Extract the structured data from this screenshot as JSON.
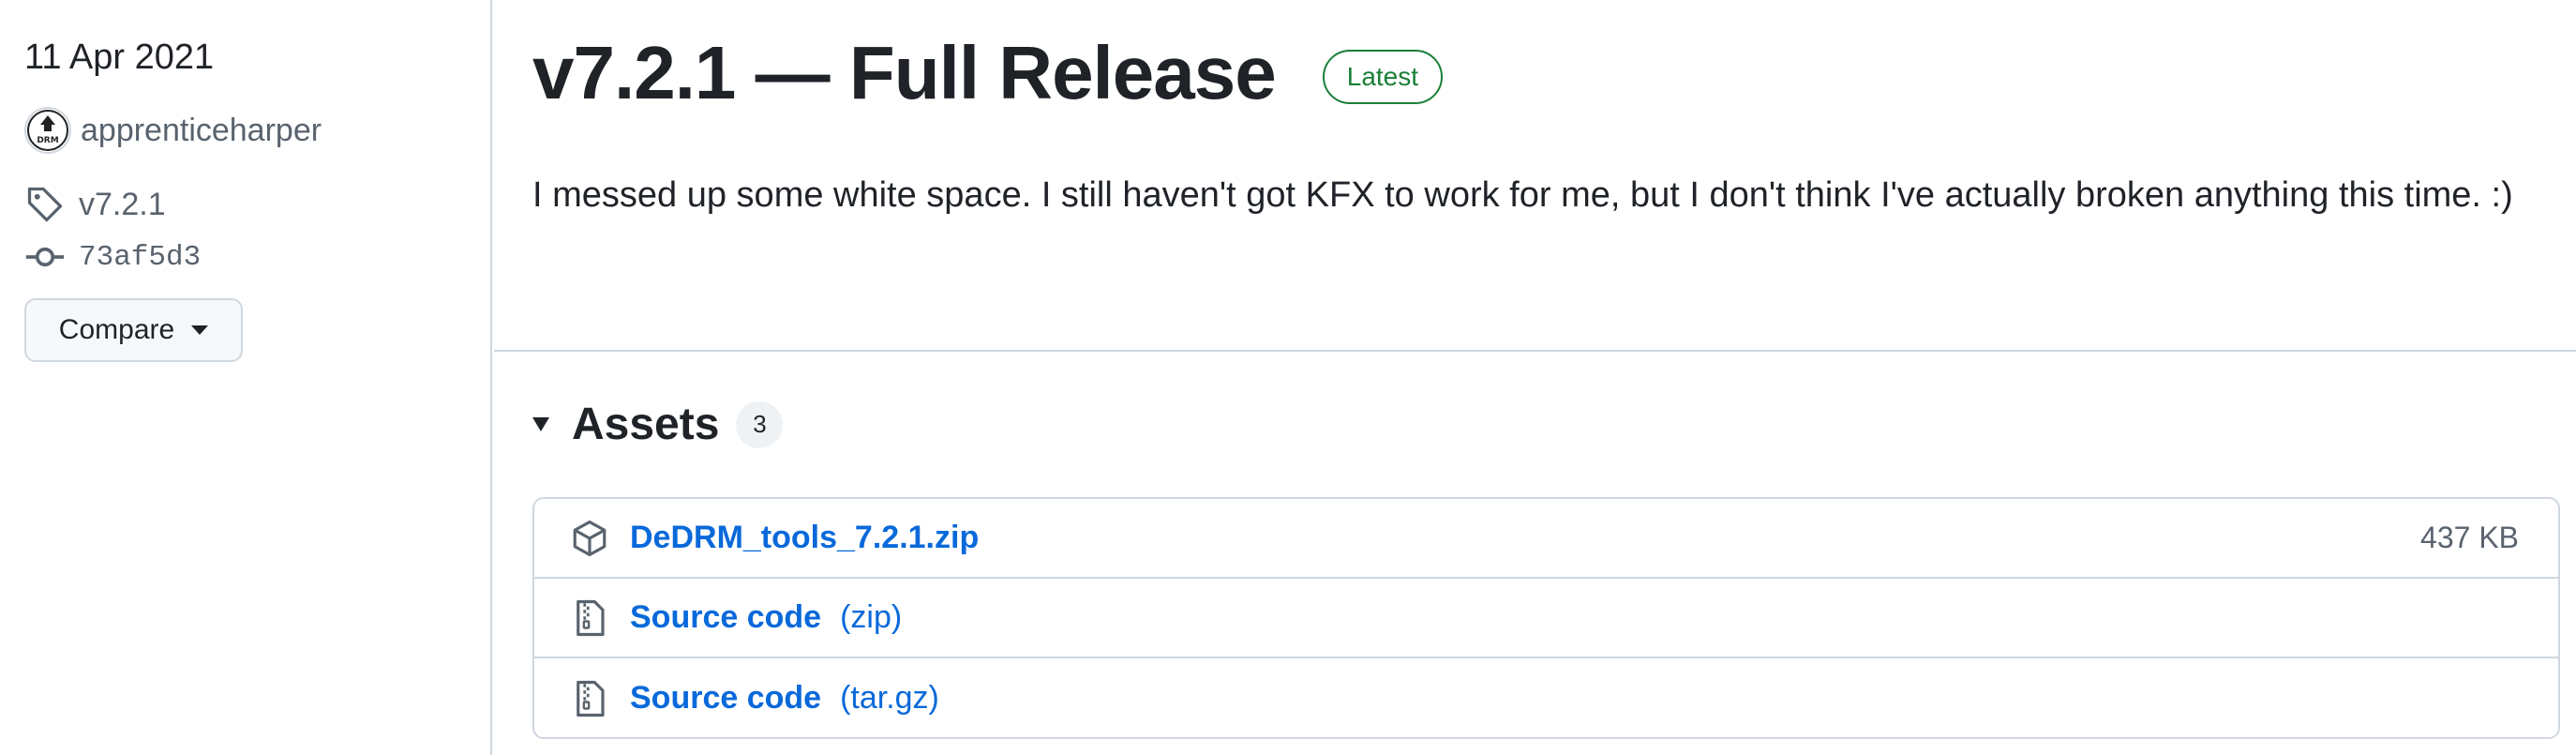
{
  "sidebar": {
    "date": "11 Apr 2021",
    "author": "apprenticeharper",
    "avatar_text": "DRM",
    "tag": "v7.2.1",
    "commit": "73af5d3",
    "compare_label": "Compare"
  },
  "release": {
    "title": "v7.2.1 — Full Release",
    "badge": "Latest",
    "body": "I messed up some white space. I still haven't got KFX to work for me, but I don't think I've actually broken anything this time. :)"
  },
  "assets": {
    "title": "Assets",
    "count": "3",
    "items": [
      {
        "name": "DeDRM_tools_7.2.1.zip",
        "format": "",
        "size": "437 KB",
        "icon": "package-icon"
      },
      {
        "name": "Source code",
        "format": "(zip)",
        "size": "",
        "icon": "file-zip-icon"
      },
      {
        "name": "Source code",
        "format": "(tar.gz)",
        "size": "",
        "icon": "file-zip-icon"
      }
    ]
  },
  "colors": {
    "link": "#0969da",
    "latest_badge": "#1a7f37",
    "muted_text": "#59636e",
    "border": "#d0d7de"
  }
}
